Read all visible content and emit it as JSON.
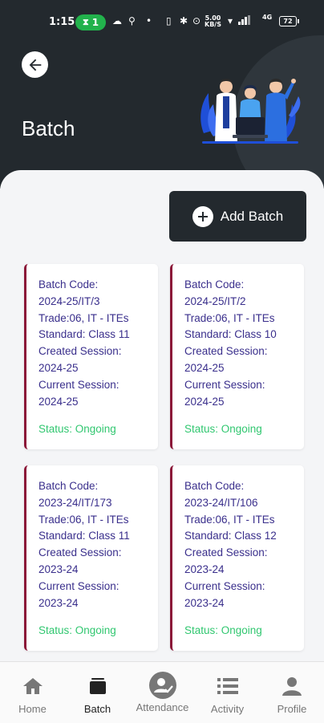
{
  "statusbar": {
    "time": "1:15",
    "notification_count": "1",
    "network_speed_value": "5.00",
    "network_speed_unit": "KB/S",
    "network_type": "4G",
    "battery": "72"
  },
  "header": {
    "title": "Batch"
  },
  "actions": {
    "add_batch_label": "Add Batch"
  },
  "cards": [
    {
      "code_label": "Batch Code:",
      "code": "2024-25/IT/3",
      "trade": "Trade:06, IT - ITEs",
      "standard": "Standard: Class 11",
      "created_label": "Created Session:",
      "created": "2024-25",
      "current_label": "Current Session:",
      "current": "2024-25",
      "status": "Status: Ongoing"
    },
    {
      "code_label": "Batch Code:",
      "code": "2024-25/IT/2",
      "trade": "Trade:06, IT - ITEs",
      "standard": "Standard: Class 10",
      "created_label": "Created Session:",
      "created": "2024-25",
      "current_label": "Current Session:",
      "current": "2024-25",
      "status": "Status: Ongoing"
    },
    {
      "code_label": "Batch Code:",
      "code": "2023-24/IT/173",
      "trade": "Trade:06, IT - ITEs",
      "standard": "Standard: Class 11",
      "created_label": "Created Session:",
      "created": "2023-24",
      "current_label": "Current Session:",
      "current": "2023-24",
      "status": "Status: Ongoing"
    },
    {
      "code_label": "Batch Code:",
      "code": "2023-24/IT/106",
      "trade": "Trade:06, IT - ITEs",
      "standard": "Standard: Class 12",
      "created_label": "Created Session:",
      "created": "2023-24",
      "current_label": "Current Session:",
      "current": "2023-24",
      "status": "Status: Ongoing"
    }
  ],
  "bottom_nav": {
    "items": [
      {
        "label": "Home",
        "icon": "home-icon"
      },
      {
        "label": "Batch",
        "icon": "batch-icon"
      },
      {
        "label": "Attendance",
        "icon": "attendance-icon"
      },
      {
        "label": "Activity",
        "icon": "list-icon"
      },
      {
        "label": "Profile",
        "icon": "profile-icon"
      }
    ],
    "active": "Batch"
  },
  "colors": {
    "header_bg": "#23292e",
    "card_accent": "#8b1538",
    "card_text": "#3a2f8c",
    "status_green": "#31c770",
    "notification_pill": "#22b24c"
  }
}
